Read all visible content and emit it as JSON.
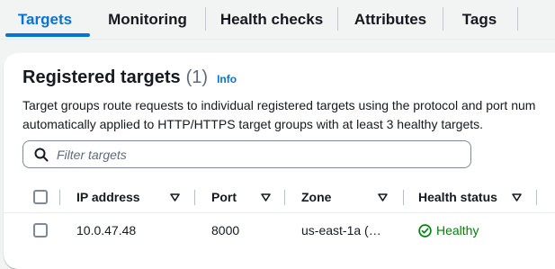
{
  "tabs": [
    {
      "label": "Targets",
      "active": true
    },
    {
      "label": "Monitoring",
      "active": false
    },
    {
      "label": "Health checks",
      "active": false
    },
    {
      "label": "Attributes",
      "active": false
    },
    {
      "label": "Tags",
      "active": false
    }
  ],
  "panel": {
    "title": "Registered targets",
    "count": "(1)",
    "info_link": "Info",
    "description_line1": "Target groups route requests to individual registered targets using the protocol and port num",
    "description_line2": "automatically applied to HTTP/HTTPS target groups with at least 3 healthy targets.",
    "search_placeholder": "Filter targets"
  },
  "table": {
    "columns": [
      "IP address",
      "Port",
      "Zone",
      "Health status"
    ],
    "rows": [
      {
        "ip": "10.0.47.48",
        "port": "8000",
        "zone": "us-east-1a (…",
        "health": "Healthy"
      }
    ]
  },
  "colors": {
    "accent": "#0972d3",
    "healthy": "#037f0c",
    "text": "#16191f"
  }
}
